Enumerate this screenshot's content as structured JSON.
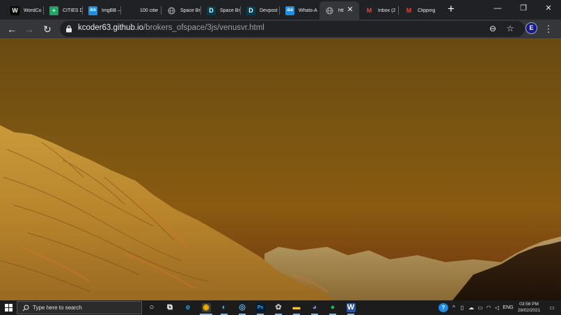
{
  "browser": {
    "tabs": [
      {
        "title": "WordCo",
        "icon_text": "W",
        "icon_bg": "#000000",
        "icon_fg": "#ffffff",
        "icon": "word-icon",
        "active": false
      },
      {
        "title": "CITIES Di",
        "icon_text": "+",
        "icon_bg": "#1fa463",
        "icon_fg": "#ffffff",
        "icon": "sheets-icon",
        "active": false
      },
      {
        "title": "ImgBB –",
        "icon_text": "ibb",
        "icon_bg": "#1f8ee0",
        "icon_fg": "#ffffff",
        "icon": "imgbb-icon",
        "active": false
      },
      {
        "title": "100 citie",
        "icon_text": "",
        "icon_bg": "#202124",
        "icon_fg": "#ffffff",
        "icon": "blank-icon",
        "active": false
      },
      {
        "title": "Space Br",
        "icon_text": "",
        "icon_bg": "#202124",
        "icon_fg": "#9aa0a6",
        "icon": "globe-icon",
        "active": false
      },
      {
        "title": "Space Br",
        "icon_text": "D",
        "icon_bg": "#003e54",
        "icon_fg": "#ffffff",
        "icon": "devpost-icon",
        "active": false
      },
      {
        "title": "Devpost",
        "icon_text": "D",
        "icon_bg": "#003e54",
        "icon_fg": "#ffffff",
        "icon": "devpost-icon",
        "active": false
      },
      {
        "title": "Whats-A",
        "icon_text": "ibb",
        "icon_bg": "#1f8ee0",
        "icon_fg": "#ffffff",
        "icon": "imgbb-icon",
        "active": false
      },
      {
        "title": "htt",
        "icon_text": "",
        "icon_bg": "#35363a",
        "icon_fg": "#9aa0a6",
        "icon": "globe-icon",
        "active": true
      },
      {
        "title": "Inbox (2",
        "icon_text": "M",
        "icon_bg": "#202124",
        "icon_fg": "#ea4335",
        "icon": "gmail-icon",
        "active": false
      },
      {
        "title": "Clipping",
        "icon_text": "M",
        "icon_bg": "#202124",
        "icon_fg": "#ea4335",
        "icon": "gmail-icon",
        "active": false
      }
    ],
    "new_tab_label": "+",
    "close_tab_label": "✕",
    "window_controls": {
      "minimize": "—",
      "maximize": "❐",
      "close": "✕"
    },
    "nav": {
      "back": "←",
      "forward": "→",
      "reload": "↻"
    },
    "url_host": "kcoder63.github.io",
    "url_path": "/brokers_ofspace/3js/venusvr.html",
    "zoom_icon": "⊖",
    "star_icon": "☆",
    "menu_icon": "⋮",
    "avatar_text": "E"
  },
  "taskbar": {
    "search_placeholder": "Type here to search",
    "apps": [
      {
        "name": "cortana-icon",
        "glyph": "○",
        "bg": "transparent",
        "fg": "#ffffff"
      },
      {
        "name": "task-view-icon",
        "glyph": "⧉",
        "bg": "transparent",
        "fg": "#ffffff"
      },
      {
        "name": "ie-icon",
        "glyph": "e",
        "bg": "transparent",
        "fg": "#1ea0e8"
      },
      {
        "name": "chrome-icon",
        "glyph": "◉",
        "bg": "#3a3a3a",
        "fg": "#f4b400"
      },
      {
        "name": "edge-icon",
        "glyph": "◐",
        "bg": "transparent",
        "fg": "#2fbcd8"
      },
      {
        "name": "app-icon",
        "glyph": "◎",
        "bg": "transparent",
        "fg": "#5fb0e8"
      },
      {
        "name": "photoshop-icon",
        "glyph": "Ps",
        "bg": "#001d34",
        "fg": "#31a8ff"
      },
      {
        "name": "davinci-icon",
        "glyph": "✿",
        "bg": "transparent",
        "fg": "#c0c0c0"
      },
      {
        "name": "file-explorer-icon",
        "glyph": "▬",
        "bg": "transparent",
        "fg": "#f5c242"
      },
      {
        "name": "discord-icon",
        "glyph": "◕",
        "bg": "transparent",
        "fg": "#7289da"
      },
      {
        "name": "spotify-icon",
        "glyph": "●",
        "bg": "transparent",
        "fg": "#1db954"
      },
      {
        "name": "word-app-icon",
        "glyph": "W",
        "bg": "#2b579a",
        "fg": "#ffffff"
      }
    ],
    "tray": {
      "help_icon": "?",
      "chevron_icon": "^",
      "lang": "ENG",
      "time": "03:56 PM",
      "date": "28/02/2021",
      "notif_icon": "▭"
    }
  }
}
